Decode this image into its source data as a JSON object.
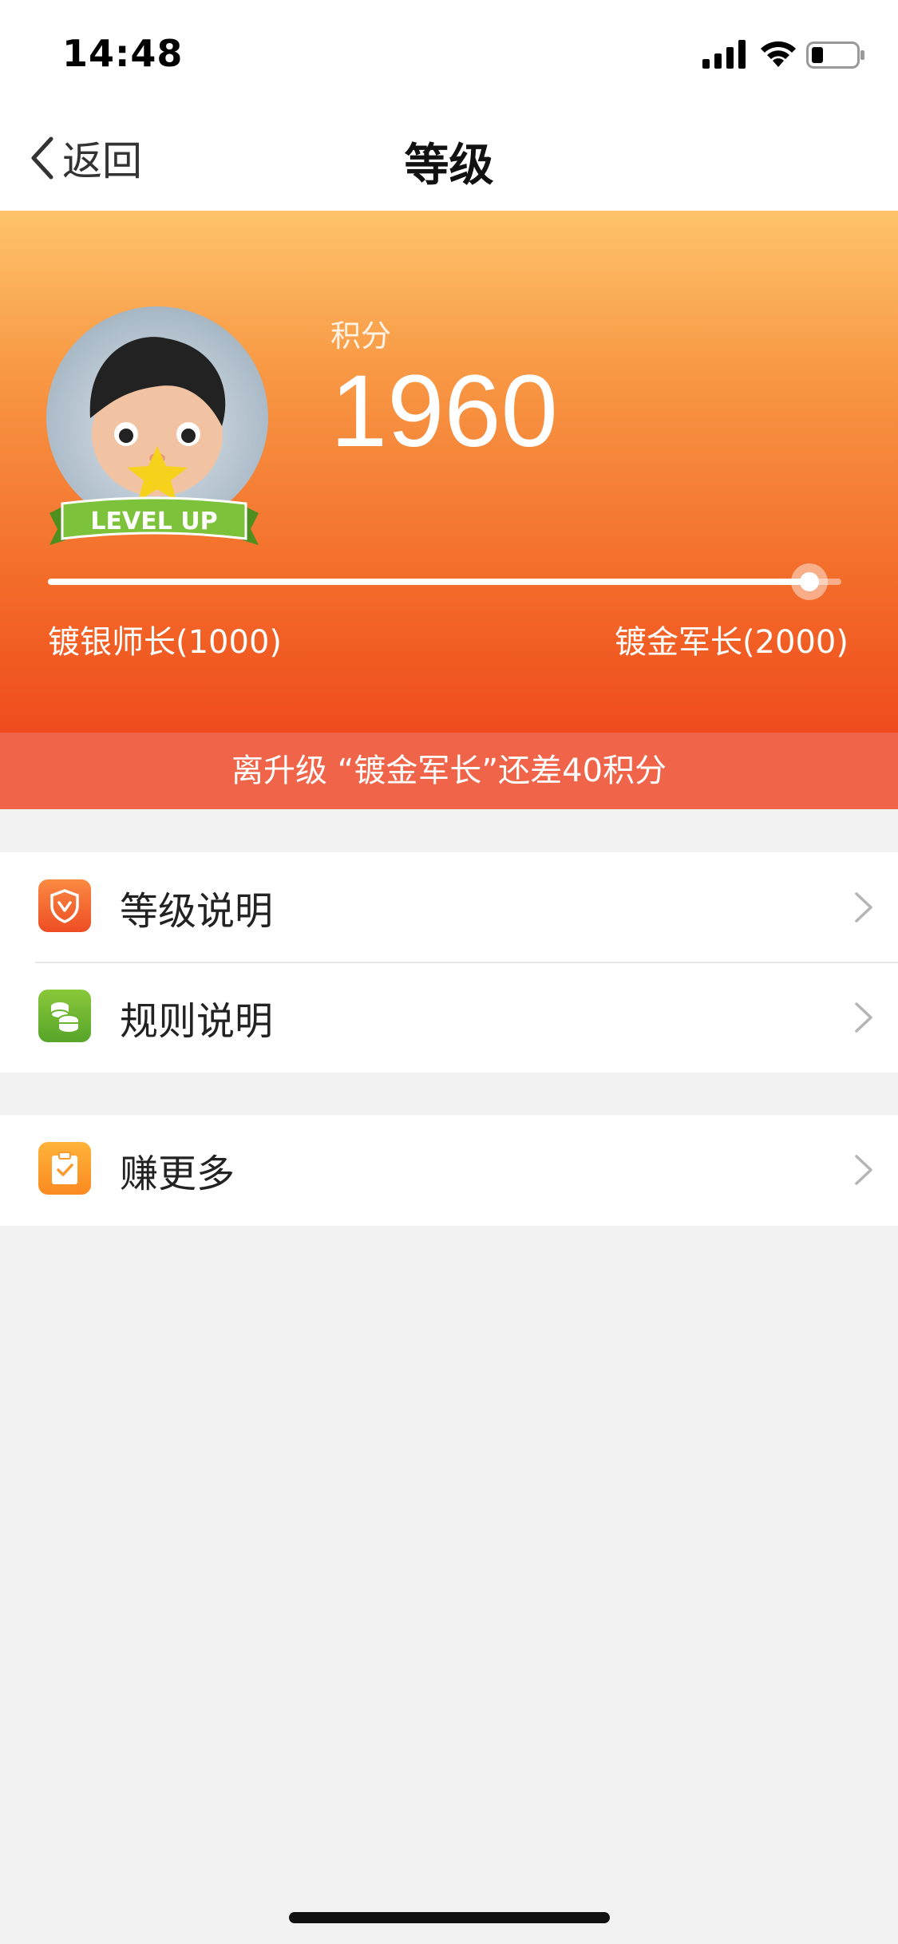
{
  "status_bar": {
    "time": "14:48"
  },
  "nav": {
    "back_label": "返回",
    "title": "等级"
  },
  "hero": {
    "points_label": "积分",
    "points_value": "1960",
    "badge_text": "LEVEL UP",
    "current_level": "镀银师长(1000)",
    "next_level": "镀金军长(2000)",
    "progress_fraction": 0.96,
    "upgrade_hint": "离升级 “镀金军长”还差40积分"
  },
  "menu": {
    "group1": [
      {
        "label": "等级说明",
        "icon": "shield-icon"
      },
      {
        "label": "规则说明",
        "icon": "coins-icon"
      }
    ],
    "group2": [
      {
        "label": "赚更多",
        "icon": "clipboard-check-icon"
      }
    ]
  },
  "colors": {
    "accent_top": "#fec46b",
    "accent_bottom": "#ef4b1d",
    "strip": "#f0654a",
    "background": "#f2f2f2"
  }
}
